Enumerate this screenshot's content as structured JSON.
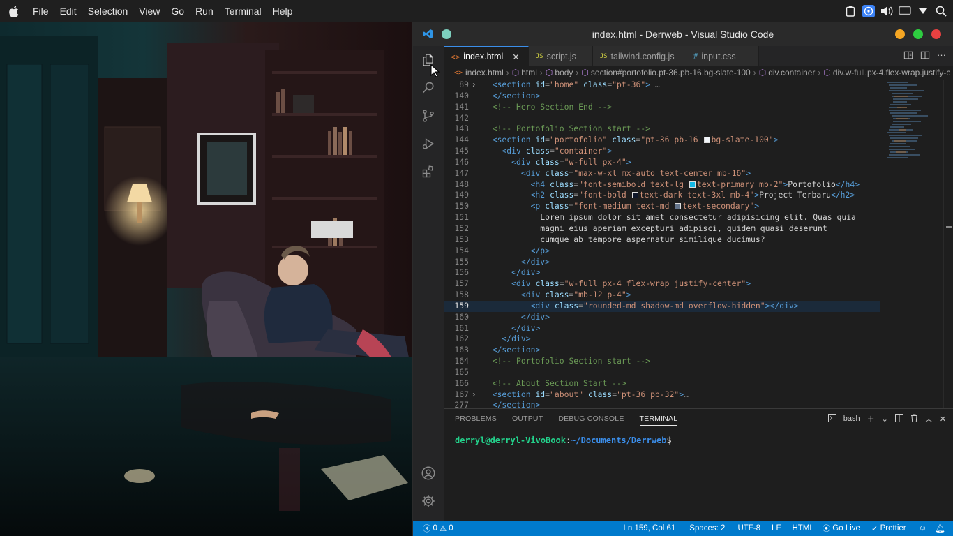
{
  "topbar": {
    "menus": [
      "File",
      "Edit",
      "Selection",
      "View",
      "Go",
      "Run",
      "Terminal",
      "Help"
    ]
  },
  "window": {
    "title": "index.html - Derrweb - Visual Studio Code",
    "accent": "#007acc",
    "traffic_colors": [
      "#f5a623",
      "#2ecc40",
      "#e84141"
    ],
    "badge_color": "#6fc3b5"
  },
  "tabs": [
    {
      "label": "index.html",
      "icon": "<>",
      "icon_color": "#e37933"
    },
    {
      "label": "script.js",
      "icon": "JS",
      "icon_color": "#cbcb41"
    },
    {
      "label": "tailwind.config.js",
      "icon": "JS",
      "icon_color": "#cbcb41"
    },
    {
      "label": "input.css",
      "icon": "#",
      "icon_color": "#519aba"
    }
  ],
  "breadcrumb": [
    "index.html",
    "html",
    "body",
    "section#portofolio.pt-36.pb-16.bg-slate-100",
    "div.container",
    "div.w-full.px-4.flex-wrap.justify-c"
  ],
  "editor": {
    "lines": [
      {
        "n": "89",
        "fold": true,
        "parts": [
          [
            "",
            "  "
          ],
          [
            "tg",
            "<section"
          ],
          [
            "at",
            " id"
          ],
          [
            "pun",
            "="
          ],
          [
            "st",
            "\"home\""
          ],
          [
            "at",
            " class"
          ],
          [
            "pun",
            "="
          ],
          [
            "st",
            "\"pt-36\""
          ],
          [
            "tg",
            ">"
          ],
          [
            "pun",
            " …"
          ]
        ]
      },
      {
        "n": "140",
        "parts": [
          [
            "",
            "  "
          ],
          [
            "tg",
            "</section>"
          ]
        ]
      },
      {
        "n": "141",
        "parts": [
          [
            "",
            "  "
          ],
          [
            "cm",
            "<!-- Hero Section End -->"
          ]
        ]
      },
      {
        "n": "142",
        "parts": []
      },
      {
        "n": "143",
        "parts": [
          [
            "",
            "  "
          ],
          [
            "cm",
            "<!-- Portofolio Section start -->"
          ]
        ]
      },
      {
        "n": "144",
        "parts": [
          [
            "",
            "  "
          ],
          [
            "tg",
            "<section"
          ],
          [
            "at",
            " id"
          ],
          [
            "pun",
            "="
          ],
          [
            "st",
            "\"portofolio\""
          ],
          [
            "at",
            " class"
          ],
          [
            "pun",
            "="
          ],
          [
            "st",
            "\"pt-36 pb-16 "
          ],
          [
            "sw",
            "#f1f5f9"
          ],
          [
            "st",
            "bg-slate-100\""
          ],
          [
            "tg",
            ">"
          ]
        ]
      },
      {
        "n": "145",
        "parts": [
          [
            "",
            "    "
          ],
          [
            "tg",
            "<div"
          ],
          [
            "at",
            " class"
          ],
          [
            "pun",
            "="
          ],
          [
            "st",
            "\"container\""
          ],
          [
            "tg",
            ">"
          ]
        ]
      },
      {
        "n": "146",
        "parts": [
          [
            "",
            "      "
          ],
          [
            "tg",
            "<div"
          ],
          [
            "at",
            " class"
          ],
          [
            "pun",
            "="
          ],
          [
            "st",
            "\"w-full px-4\""
          ],
          [
            "tg",
            ">"
          ]
        ]
      },
      {
        "n": "147",
        "parts": [
          [
            "",
            "        "
          ],
          [
            "tg",
            "<div"
          ],
          [
            "at",
            " class"
          ],
          [
            "pun",
            "="
          ],
          [
            "st",
            "\"max-w-xl mx-auto text-center mb-16\""
          ],
          [
            "tg",
            ">"
          ]
        ]
      },
      {
        "n": "148",
        "parts": [
          [
            "",
            "          "
          ],
          [
            "tg",
            "<h4"
          ],
          [
            "at",
            " class"
          ],
          [
            "pun",
            "="
          ],
          [
            "st",
            "\"font-semibold text-lg "
          ],
          [
            "sw",
            "#14b8e6"
          ],
          [
            "st",
            "text-primary mb-2\""
          ],
          [
            "tg",
            ">"
          ],
          [
            "txt",
            "Portofolio"
          ],
          [
            "tg",
            "</h4>"
          ]
        ]
      },
      {
        "n": "149",
        "parts": [
          [
            "",
            "          "
          ],
          [
            "tg",
            "<h2"
          ],
          [
            "at",
            " class"
          ],
          [
            "pun",
            "="
          ],
          [
            "st",
            "\"font-bold "
          ],
          [
            "sw",
            "#0f172a"
          ],
          [
            "st",
            "text-dark text-3xl mb-4\""
          ],
          [
            "tg",
            ">"
          ],
          [
            "txt",
            "Project Terbaru"
          ],
          [
            "tg",
            "</h2>"
          ]
        ]
      },
      {
        "n": "150",
        "parts": [
          [
            "",
            "          "
          ],
          [
            "tg",
            "<p"
          ],
          [
            "at",
            " class"
          ],
          [
            "pun",
            "="
          ],
          [
            "st",
            "\"font-medium text-md "
          ],
          [
            "sw",
            "#64748b"
          ],
          [
            "st",
            "text-secondary\""
          ],
          [
            "tg",
            ">"
          ]
        ]
      },
      {
        "n": "151",
        "parts": [
          [
            "",
            "            "
          ],
          [
            "txt",
            "Lorem ipsum dolor sit amet consectetur adipisicing elit. Quas quia"
          ]
        ]
      },
      {
        "n": "152",
        "parts": [
          [
            "",
            "            "
          ],
          [
            "txt",
            "magni eius aperiam excepturi adipisci, quidem quasi deserunt"
          ]
        ]
      },
      {
        "n": "153",
        "parts": [
          [
            "",
            "            "
          ],
          [
            "txt",
            "cumque ab tempore aspernatur similique ducimus?"
          ]
        ]
      },
      {
        "n": "154",
        "parts": [
          [
            "",
            "          "
          ],
          [
            "tg",
            "</p>"
          ]
        ]
      },
      {
        "n": "155",
        "parts": [
          [
            "",
            "        "
          ],
          [
            "tg",
            "</div>"
          ]
        ]
      },
      {
        "n": "156",
        "parts": [
          [
            "",
            "      "
          ],
          [
            "tg",
            "</div>"
          ]
        ]
      },
      {
        "n": "157",
        "parts": [
          [
            "",
            "      "
          ],
          [
            "tg",
            "<div"
          ],
          [
            "at",
            " class"
          ],
          [
            "pun",
            "="
          ],
          [
            "st",
            "\"w-full px-4 flex-wrap justify-center\""
          ],
          [
            "tg",
            ">"
          ]
        ]
      },
      {
        "n": "158",
        "parts": [
          [
            "",
            "        "
          ],
          [
            "tg",
            "<div"
          ],
          [
            "at",
            " class"
          ],
          [
            "pun",
            "="
          ],
          [
            "st",
            "\"mb-12 p-4\""
          ],
          [
            "tg",
            ">"
          ]
        ]
      },
      {
        "n": "159",
        "cur": true,
        "parts": [
          [
            "",
            "          "
          ],
          [
            "tg",
            "<div"
          ],
          [
            "at",
            " class"
          ],
          [
            "pun",
            "="
          ],
          [
            "st",
            "\"rounded-md shadow-md overflow-hidden\""
          ],
          [
            "tg",
            ">"
          ],
          [
            "tg",
            "</div>"
          ]
        ]
      },
      {
        "n": "160",
        "parts": [
          [
            "",
            "        "
          ],
          [
            "tg",
            "</div>"
          ]
        ]
      },
      {
        "n": "161",
        "parts": [
          [
            "",
            "      "
          ],
          [
            "tg",
            "</div>"
          ]
        ]
      },
      {
        "n": "162",
        "parts": [
          [
            "",
            "    "
          ],
          [
            "tg",
            "</div>"
          ]
        ]
      },
      {
        "n": "163",
        "parts": [
          [
            "",
            "  "
          ],
          [
            "tg",
            "</section>"
          ]
        ]
      },
      {
        "n": "164",
        "parts": [
          [
            "",
            "  "
          ],
          [
            "cm",
            "<!-- Portofolio Section start -->"
          ]
        ]
      },
      {
        "n": "165",
        "parts": []
      },
      {
        "n": "166",
        "parts": [
          [
            "",
            "  "
          ],
          [
            "cm",
            "<!-- About Section Start -->"
          ]
        ]
      },
      {
        "n": "167",
        "fold": true,
        "parts": [
          [
            "",
            "  "
          ],
          [
            "tg",
            "<section"
          ],
          [
            "at",
            " id"
          ],
          [
            "pun",
            "="
          ],
          [
            "st",
            "\"about\""
          ],
          [
            "at",
            " class"
          ],
          [
            "pun",
            "="
          ],
          [
            "st",
            "\"pt-36 pb-32\""
          ],
          [
            "tg",
            ">"
          ],
          [
            "pun",
            "…"
          ]
        ]
      },
      {
        "n": "277",
        "parts": [
          [
            "",
            "  "
          ],
          [
            "tg",
            "</section>"
          ]
        ]
      }
    ]
  },
  "panel": {
    "tabs": [
      "PROBLEMS",
      "OUTPUT",
      "DEBUG CONSOLE",
      "TERMINAL"
    ],
    "active_tab": "TERMINAL",
    "shell": "bash",
    "prompt_user": "derryl@derryl-VivoBook",
    "prompt_sep": ":",
    "prompt_path": "~/Documents/Derrweb",
    "prompt_end": "$"
  },
  "statusbar": {
    "errors": "0",
    "warnings": "0",
    "position": "Ln 159, Col 61",
    "spaces": "Spaces: 2",
    "encoding": "UTF-8",
    "eol": "LF",
    "language": "HTML",
    "golive": "Go Live",
    "prettier": "Prettier"
  }
}
